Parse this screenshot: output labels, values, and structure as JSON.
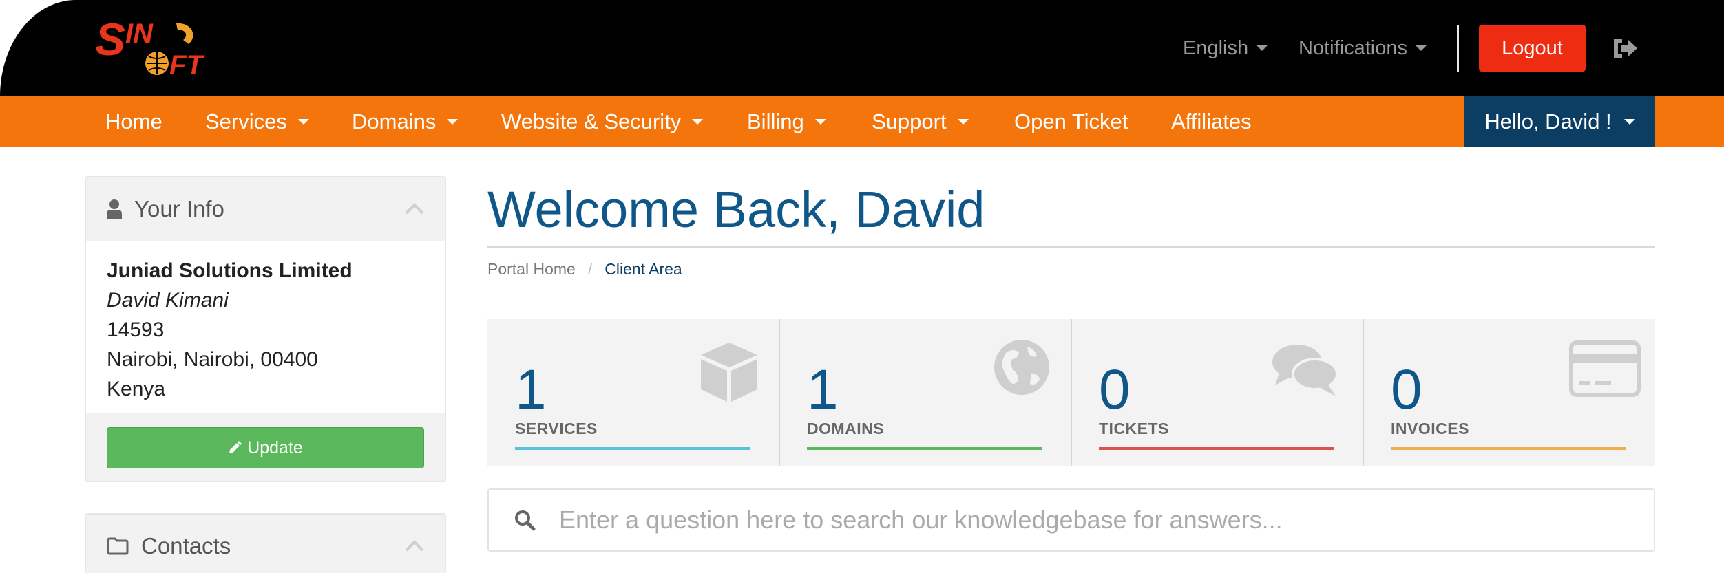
{
  "header": {
    "logo_text": "SINGSOFT",
    "language_label": "English",
    "notifications_label": "Notifications",
    "logout_label": "Logout"
  },
  "nav": {
    "items": [
      {
        "label": "Home",
        "has_caret": false
      },
      {
        "label": "Services",
        "has_caret": true
      },
      {
        "label": "Domains",
        "has_caret": true
      },
      {
        "label": "Website & Security",
        "has_caret": true
      },
      {
        "label": "Billing",
        "has_caret": true
      },
      {
        "label": "Support",
        "has_caret": true
      },
      {
        "label": "Open Ticket",
        "has_caret": false
      },
      {
        "label": "Affiliates",
        "has_caret": false
      }
    ],
    "user_label": "Hello, David !"
  },
  "sidebar": {
    "your_info": {
      "title": "Your Info",
      "company": "Juniad Solutions Limited",
      "name": "David Kimani",
      "address_line": "14593",
      "city_line": "Nairobi, Nairobi, 00400",
      "country": "Kenya",
      "update_label": "Update"
    },
    "contacts": {
      "title": "Contacts"
    }
  },
  "main": {
    "title": "Welcome Back, David",
    "breadcrumb": {
      "home": "Portal Home",
      "separator": "/",
      "current": "Client Area"
    },
    "stats": [
      {
        "count": "1",
        "label": "SERVICES",
        "color": "#5bc0de",
        "icon": "cube-icon"
      },
      {
        "count": "1",
        "label": "DOMAINS",
        "color": "#5cb85c",
        "icon": "globe-icon"
      },
      {
        "count": "0",
        "label": "TICKETS",
        "color": "#d9534f",
        "icon": "comments-icon"
      },
      {
        "count": "0",
        "label": "INVOICES",
        "color": "#f0ad4e",
        "icon": "credit-card-icon"
      }
    ],
    "kb_search": {
      "placeholder": "Enter a question here to search our knowledgebase for answers..."
    }
  },
  "colors": {
    "nav_orange": "#f4750b",
    "brand_blue": "#0f5689",
    "user_dark": "#0c3e64",
    "logout_red": "#ee2c12"
  }
}
